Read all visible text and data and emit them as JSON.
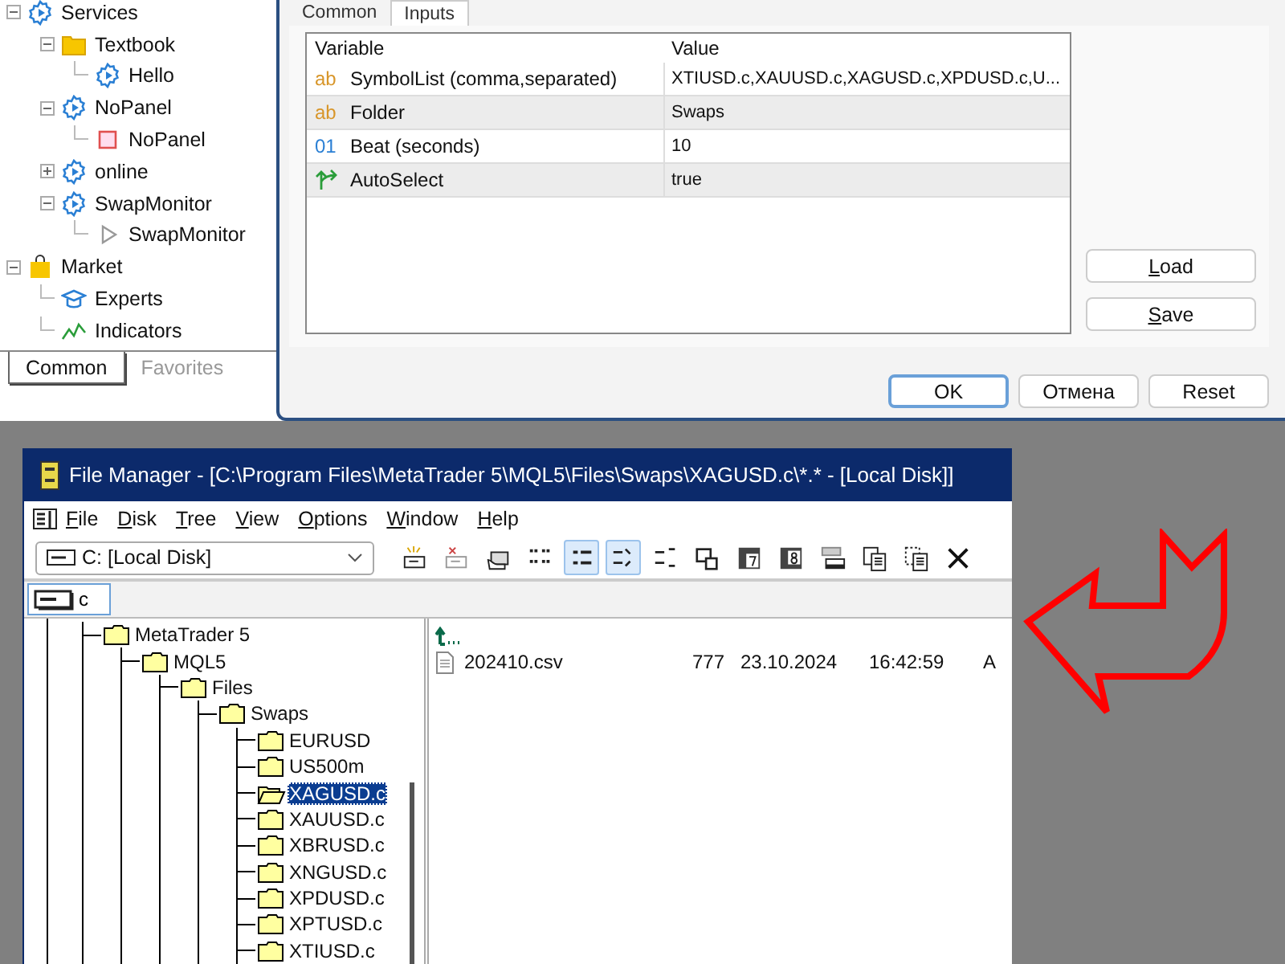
{
  "navigator": {
    "tree": [
      {
        "label": "Services",
        "kind": "service",
        "expanded": true,
        "children": [
          {
            "label": "Textbook",
            "kind": "folder",
            "expanded": true,
            "children": [
              {
                "label": "Hello",
                "kind": "service"
              }
            ]
          },
          {
            "label": "NoPanel",
            "kind": "service",
            "expanded": true,
            "children": [
              {
                "label": "NoPanel",
                "kind": "stopped"
              }
            ]
          },
          {
            "label": "online",
            "kind": "service",
            "expanded": false
          },
          {
            "label": "SwapMonitor",
            "kind": "service",
            "expanded": true,
            "children": [
              {
                "label": "SwapMonitor",
                "kind": "script"
              }
            ]
          }
        ]
      },
      {
        "label": "Market",
        "kind": "market",
        "expanded": true,
        "children": [
          {
            "label": "Experts",
            "kind": "experts"
          },
          {
            "label": "Indicators",
            "kind": "indicators"
          }
        ]
      }
    ],
    "tabs": [
      {
        "label": "Common",
        "selected": true
      },
      {
        "label": "Favorites",
        "selected": false
      }
    ]
  },
  "dialog": {
    "tabs": [
      {
        "label": "Common",
        "selected": false
      },
      {
        "label": "Inputs",
        "selected": true
      }
    ],
    "columns": [
      "Variable",
      "Value"
    ],
    "rows": [
      {
        "kind": "string",
        "icon": "ab",
        "variable": "SymbolList (comma,separated)",
        "value": "XTIUSD.c,XAUUSD.c,XAGUSD.c,XPDUSD.c,U..."
      },
      {
        "kind": "string",
        "icon": "ab",
        "variable": "Folder",
        "value": "Swaps"
      },
      {
        "kind": "int",
        "icon": "01",
        "variable": "Beat (seconds)",
        "value": "10"
      },
      {
        "kind": "bool",
        "variable": "AutoSelect",
        "value": "true"
      }
    ],
    "side_buttons": [
      "Load",
      "Save"
    ],
    "buttons": [
      {
        "label": "OK",
        "default": true
      },
      {
        "label": "Отмена",
        "default": false
      },
      {
        "label": "Reset",
        "default": false
      }
    ]
  },
  "file_manager": {
    "title": "File Manager - [C:\\Program Files\\MetaTrader 5\\MQL5\\Files\\Swaps\\XAGUSD.c\\*.* - [Local Disk]]",
    "menu": [
      "File",
      "Disk",
      "Tree",
      "View",
      "Options",
      "Window",
      "Help"
    ],
    "drive_select": "C: [Local Disk]",
    "toolbar": [
      {
        "kind": "connect",
        "pressed": false
      },
      {
        "kind": "disconnect",
        "pressed": false
      },
      {
        "kind": "share",
        "pressed": false
      },
      {
        "kind": "icons",
        "pressed": false
      },
      {
        "kind": "list",
        "pressed": true
      },
      {
        "kind": "sort-name",
        "pressed": true
      },
      {
        "kind": "sort-type",
        "pressed": false
      },
      {
        "kind": "find",
        "pressed": false
      },
      {
        "kind": "calendar-7",
        "pressed": false
      },
      {
        "kind": "calendar-8",
        "pressed": false
      },
      {
        "kind": "window",
        "pressed": false
      },
      {
        "kind": "copy",
        "pressed": false
      },
      {
        "kind": "move",
        "pressed": false
      },
      {
        "kind": "delete",
        "pressed": false
      }
    ],
    "drive_button": "c",
    "tree": [
      {
        "label": "MetaTrader 5",
        "selected": false,
        "children": [
          {
            "label": "MQL5",
            "selected": false,
            "children": [
              {
                "label": "Files",
                "selected": false,
                "children": [
                  {
                    "label": "Swaps",
                    "selected": false,
                    "children": [
                      {
                        "label": "EURUSD",
                        "selected": false
                      },
                      {
                        "label": "US500m",
                        "selected": false
                      },
                      {
                        "label": "XAGUSD.c",
                        "selected": true
                      },
                      {
                        "label": "XAUUSD.c",
                        "selected": false
                      },
                      {
                        "label": "XBRUSD.c",
                        "selected": false
                      },
                      {
                        "label": "XNGUSD.c",
                        "selected": false
                      },
                      {
                        "label": "XPDUSD.c",
                        "selected": false
                      },
                      {
                        "label": "XPTUSD.c",
                        "selected": false
                      },
                      {
                        "label": "XTIUSD.c",
                        "selected": false
                      }
                    ]
                  }
                ]
              }
            ]
          }
        ]
      }
    ],
    "files": [
      {
        "name": "202410.csv",
        "size": "777",
        "date": "23.10.2024",
        "time": "16:42:59",
        "attributes": "A"
      }
    ]
  }
}
